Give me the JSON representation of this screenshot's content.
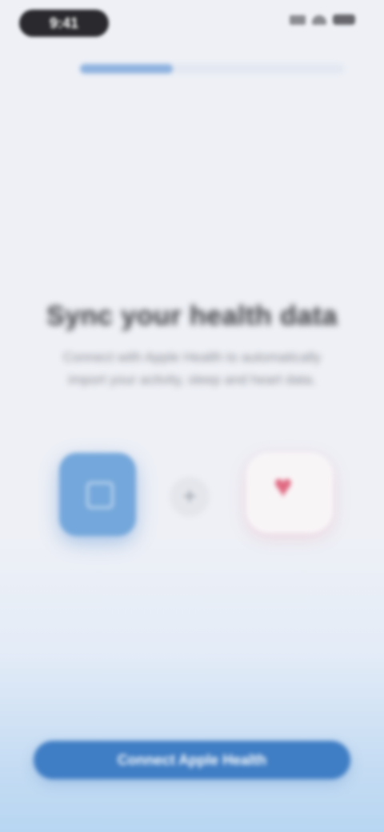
{
  "status_bar": {
    "time": "9:41",
    "icons": [
      "signal-icon",
      "wifi-icon",
      "battery-icon"
    ]
  },
  "onboarding": {
    "progress_fraction": 0.35
  },
  "hero": {
    "title": "Sync your health data",
    "subtitle": "Connect with Apple Health to automatically import your activity, sleep and heart data."
  },
  "integration": {
    "app_icon": "app-icon",
    "connector_glyph": "+",
    "health_icon": "heart-icon",
    "heart_glyph": "♥"
  },
  "cta": {
    "label": "Connect Apple Health"
  },
  "colors": {
    "accent": "#3f7dc4",
    "app_tile": "#74a7db",
    "heart": "#e06a82",
    "background": "#eef0f6"
  }
}
